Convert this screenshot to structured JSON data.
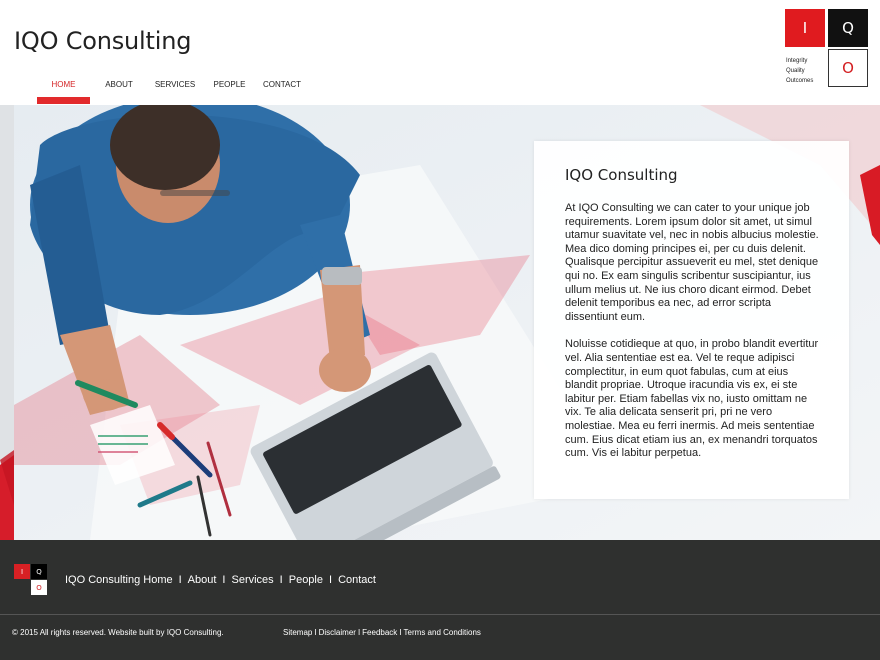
{
  "header": {
    "brand": "IQO Consulting",
    "nav": [
      "HOME",
      "ABOUT",
      "SERVICES",
      "PEOPLE",
      "CONTACT"
    ],
    "logo": {
      "i": "I",
      "q": "Q",
      "o": "O",
      "tagline": [
        "Integrity",
        "Quality",
        "Outcomes"
      ]
    }
  },
  "hero": {
    "card_title": "IQO Consulting",
    "paragraphs": [
      "At IQO Consulting we can cater to your unique job requirements. Lorem ipsum dolor sit amet, ut simul utamur suavitate vel, nec in nobis albucius molestie. Mea dico doming principes ei, per cu duis delenit. Qualisque percipitur assueverit eu mel, stet denique qui no. Ex eam singulis scribentur suscipiantur, ius ullum melius ut. Ne ius choro dicant eirmod. Debet delenit temporibus ea nec, ad error scripta dissentiunt eum.",
      "Noluisse cotidieque at quo, in probo blandit evertitur vel. Alia sententiae est ea. Vel te reque adipisci complectitur, in eum quot fabulas, cum at eius blandit propriae. Utroque iracundia vis ex, ei ste labitur per. Etiam fabellas vix no, iusto omittam ne vix. Te alia delicata senserit pri, pri ne vero molestiae. Mea eu ferri inermis. Ad meis sententiae cum. Eius dicat etiam ius an, ex menandri torquatos cum. Vis ei labitur perpetua."
    ]
  },
  "footer": {
    "logo": {
      "i": "I",
      "q": "Q",
      "o": "O"
    },
    "links": [
      "IQO Consulting Home",
      "About",
      "Services",
      "People",
      "Contact"
    ],
    "separator": "I",
    "copyright": "© 2015 All rights reserved. Website built by IQO Consulting.",
    "legal": [
      "Sitemap",
      "Disclaimer",
      "Feedback",
      "Terms and Conditions"
    ]
  },
  "colors": {
    "accent": "#e22a2c",
    "footer_bg": "#2f302f",
    "hero_bg": "#eaeef2"
  }
}
